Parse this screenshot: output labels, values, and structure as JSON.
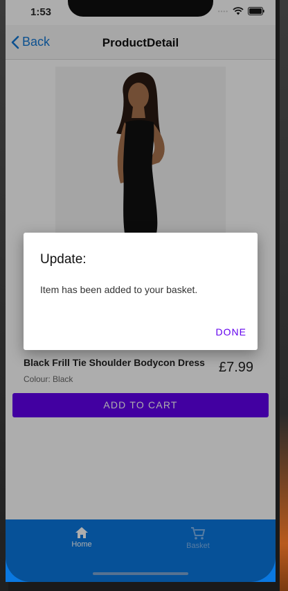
{
  "status_bar": {
    "time": "1:53"
  },
  "navbar": {
    "back_label": "Back",
    "title": "ProductDetail"
  },
  "product": {
    "name": "Black Frill Tie Shoulder Bodycon Dress",
    "colour": "Colour: Black",
    "price": "£7.99",
    "add_to_cart_label": "ADD TO CART"
  },
  "dialog": {
    "title": "Update:",
    "message": "Item has been added to your basket.",
    "done_label": "DONE"
  },
  "tabbar": {
    "tabs": [
      {
        "label": "Home",
        "icon": "home-icon",
        "active": true
      },
      {
        "label": "Basket",
        "icon": "cart-icon",
        "active": false
      }
    ]
  },
  "colors": {
    "accent": "#6200ee",
    "tabbar": "#0a78e0",
    "link": "#1478d4"
  }
}
